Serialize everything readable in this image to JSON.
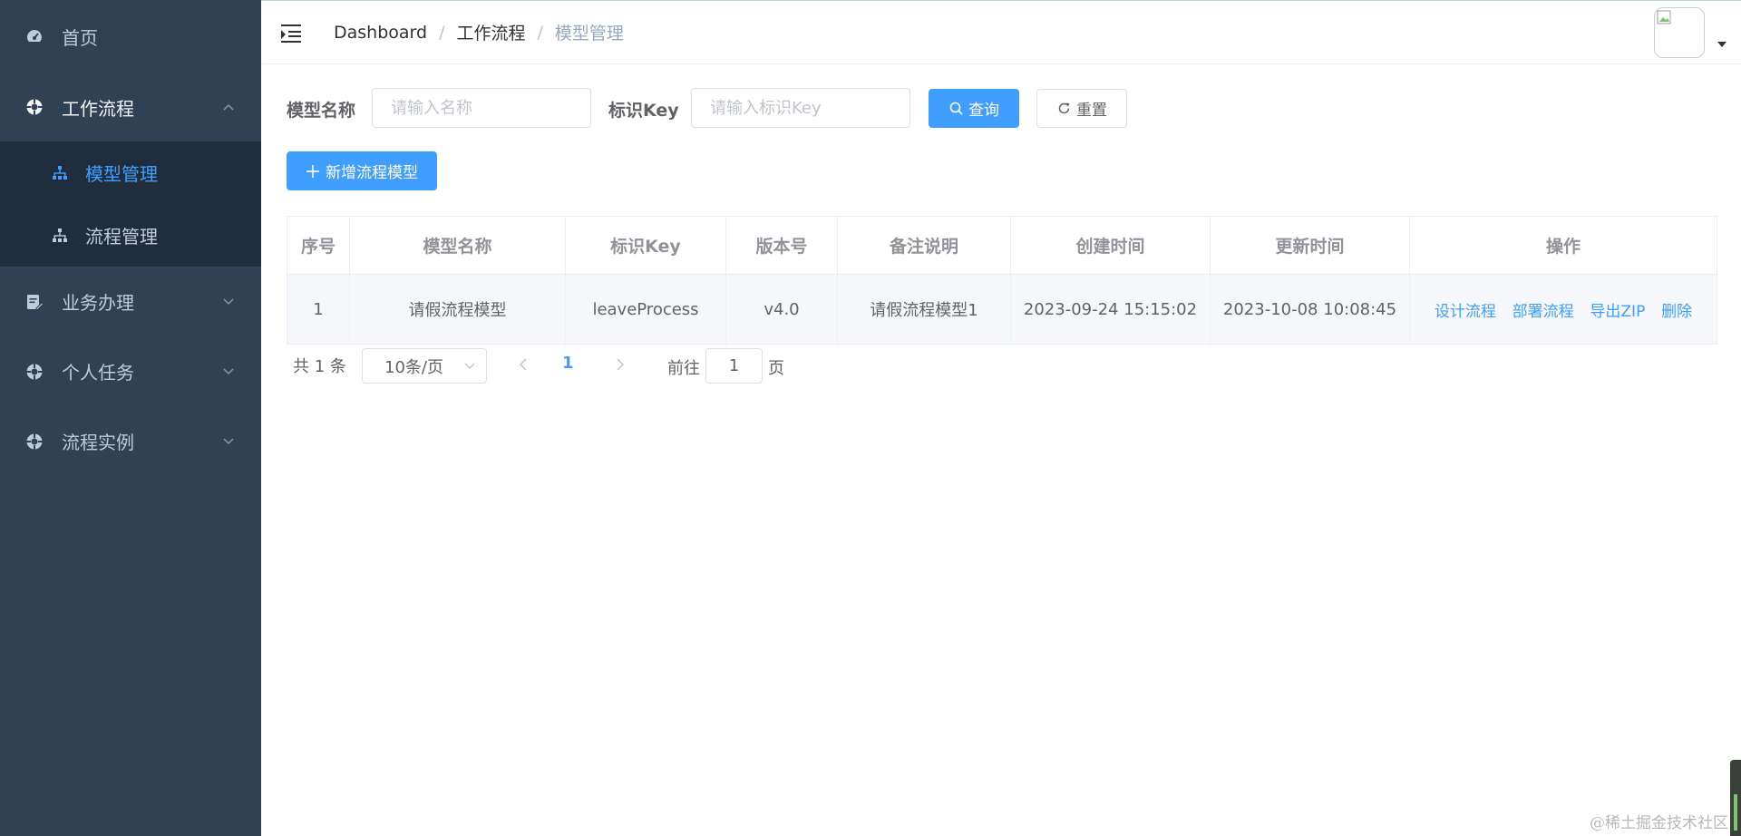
{
  "sidebar": {
    "items": [
      {
        "label": "首页",
        "icon": "dashboard-icon"
      },
      {
        "label": "工作流程",
        "icon": "workflow-icon",
        "expanded": true,
        "children": [
          {
            "label": "模型管理",
            "icon": "tree-icon",
            "active": true
          },
          {
            "label": "流程管理",
            "icon": "tree-icon",
            "active": false
          }
        ]
      },
      {
        "label": "业务办理",
        "icon": "edit-document-icon"
      },
      {
        "label": "个人任务",
        "icon": "workflow-icon"
      },
      {
        "label": "流程实例",
        "icon": "workflow-icon"
      }
    ]
  },
  "navbar": {
    "breadcrumb": [
      "Dashboard",
      "工作流程",
      "模型管理"
    ]
  },
  "search": {
    "name_label": "模型名称",
    "name_placeholder": "请输入名称",
    "name_value": "",
    "key_label": "标识Key",
    "key_placeholder": "请输入标识Key",
    "key_value": "",
    "query_label": "查询",
    "reset_label": "重置"
  },
  "toolbar": {
    "add_label": "新增流程模型"
  },
  "table": {
    "columns": [
      "序号",
      "模型名称",
      "标识Key",
      "版本号",
      "备注说明",
      "创建时间",
      "更新时间",
      "操作"
    ],
    "rows": [
      {
        "index": "1",
        "name": "请假流程模型",
        "key": "leaveProcess",
        "version": "v4.0",
        "remark": "请假流程模型1",
        "created": "2023-09-24 15:15:02",
        "updated": "2023-10-08 10:08:45",
        "actions": [
          "设计流程",
          "部署流程",
          "导出ZIP",
          "删除"
        ]
      }
    ]
  },
  "pagination": {
    "total_text": "共 1 条",
    "page_size": "10条/页",
    "current_page": "1",
    "goto_label": "前往",
    "goto_value": "1",
    "page_suffix": "页"
  },
  "watermark": "@稀土掘金技术社区",
  "colors": {
    "sidebar_bg": "#304156",
    "submenu_bg": "#1f2d3d",
    "primary": "#409eff"
  }
}
